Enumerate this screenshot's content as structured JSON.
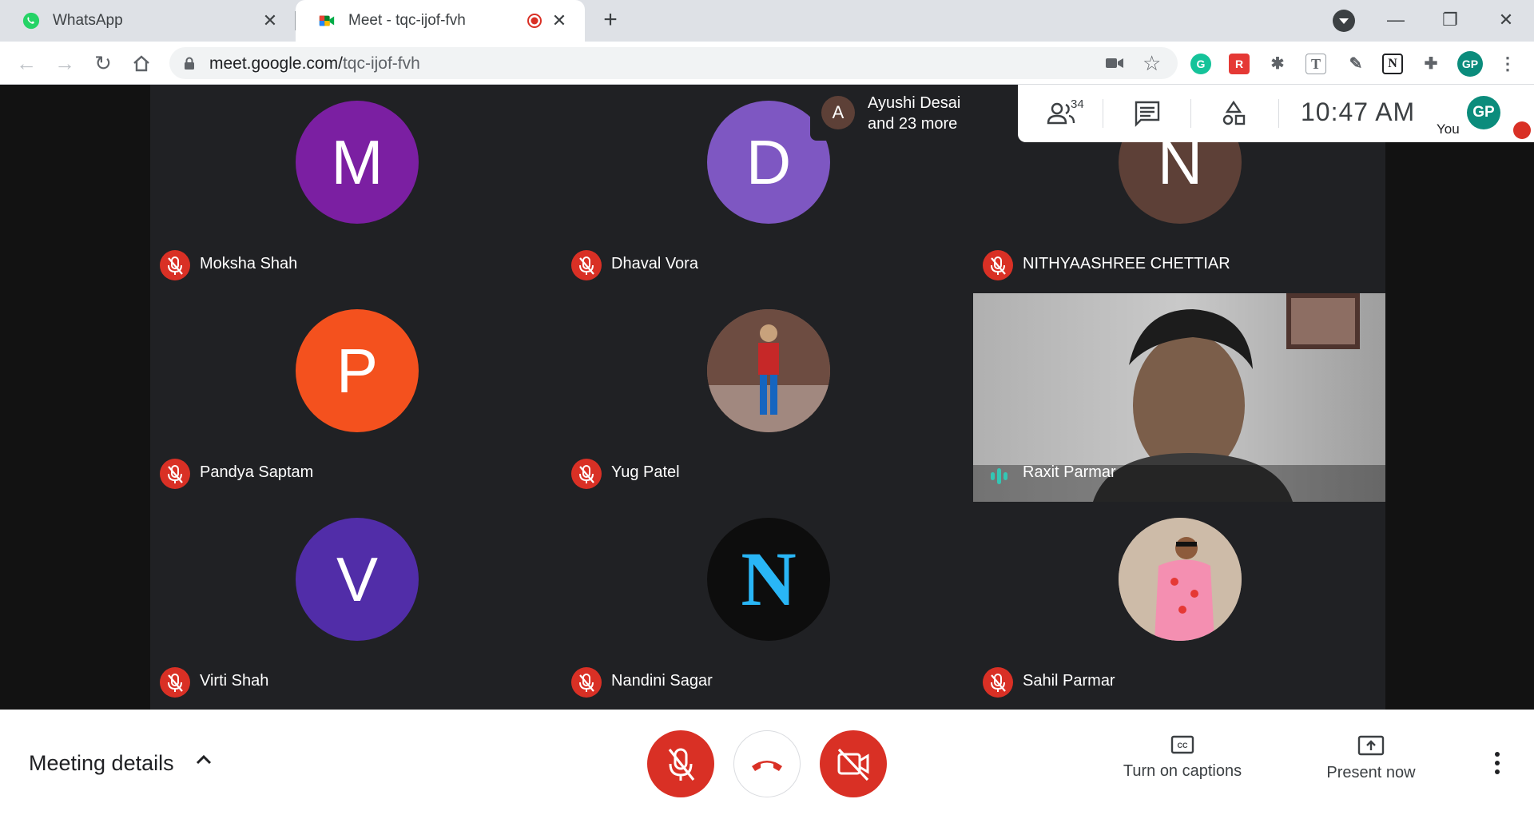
{
  "browser": {
    "tabs": [
      {
        "title": "WhatsApp",
        "active": false
      },
      {
        "title": "Meet - tqc-ijof-fvh",
        "active": true,
        "recording": true
      }
    ],
    "url_host": "meet.google.com/",
    "url_path": "tqc-ijof-fvh",
    "extensions": [
      "grammarly-icon",
      "readwise-icon",
      "bug-icon",
      "text-icon",
      "eyedropper-icon",
      "notion-icon",
      "puzzle-icon"
    ],
    "profile_initials": "GP"
  },
  "meet": {
    "presenter": {
      "initial": "A",
      "line1": "Ayushi Desai",
      "line2": "and 23 more"
    },
    "people_count": "34",
    "clock": "10:47  AM",
    "you_label": "You",
    "you_initials": "GP",
    "participants": [
      {
        "name": "Moksha Shah",
        "initial": "M",
        "color": "#7b1fa2",
        "muted": true
      },
      {
        "name": "Dhaval Vora",
        "initial": "D",
        "color": "#7e57c2",
        "muted": true
      },
      {
        "name": "NITHYAASHREE CHETTIAR",
        "initial": "N",
        "color": "#5d4037",
        "muted": true
      },
      {
        "name": "Pandya Saptam",
        "initial": "P",
        "color": "#f4511e",
        "muted": true
      },
      {
        "name": "Yug Patel",
        "initial": "",
        "color": "#8d6e63",
        "muted": true
      },
      {
        "name": "Raxit Parmar",
        "initial": "",
        "color": "",
        "muted": false,
        "video": true,
        "speaking": true
      },
      {
        "name": "Virti Shah",
        "initial": "V",
        "color": "#512da8",
        "muted": true
      },
      {
        "name": "Nandini Sagar",
        "initial": "N",
        "color": "#111111",
        "muted": true
      },
      {
        "name": "Sahil Parmar",
        "initial": "",
        "color": "#bcaaa4",
        "muted": true
      }
    ]
  },
  "controls": {
    "meeting_details": "Meeting details",
    "captions": "Turn on captions",
    "present": "Present now"
  }
}
